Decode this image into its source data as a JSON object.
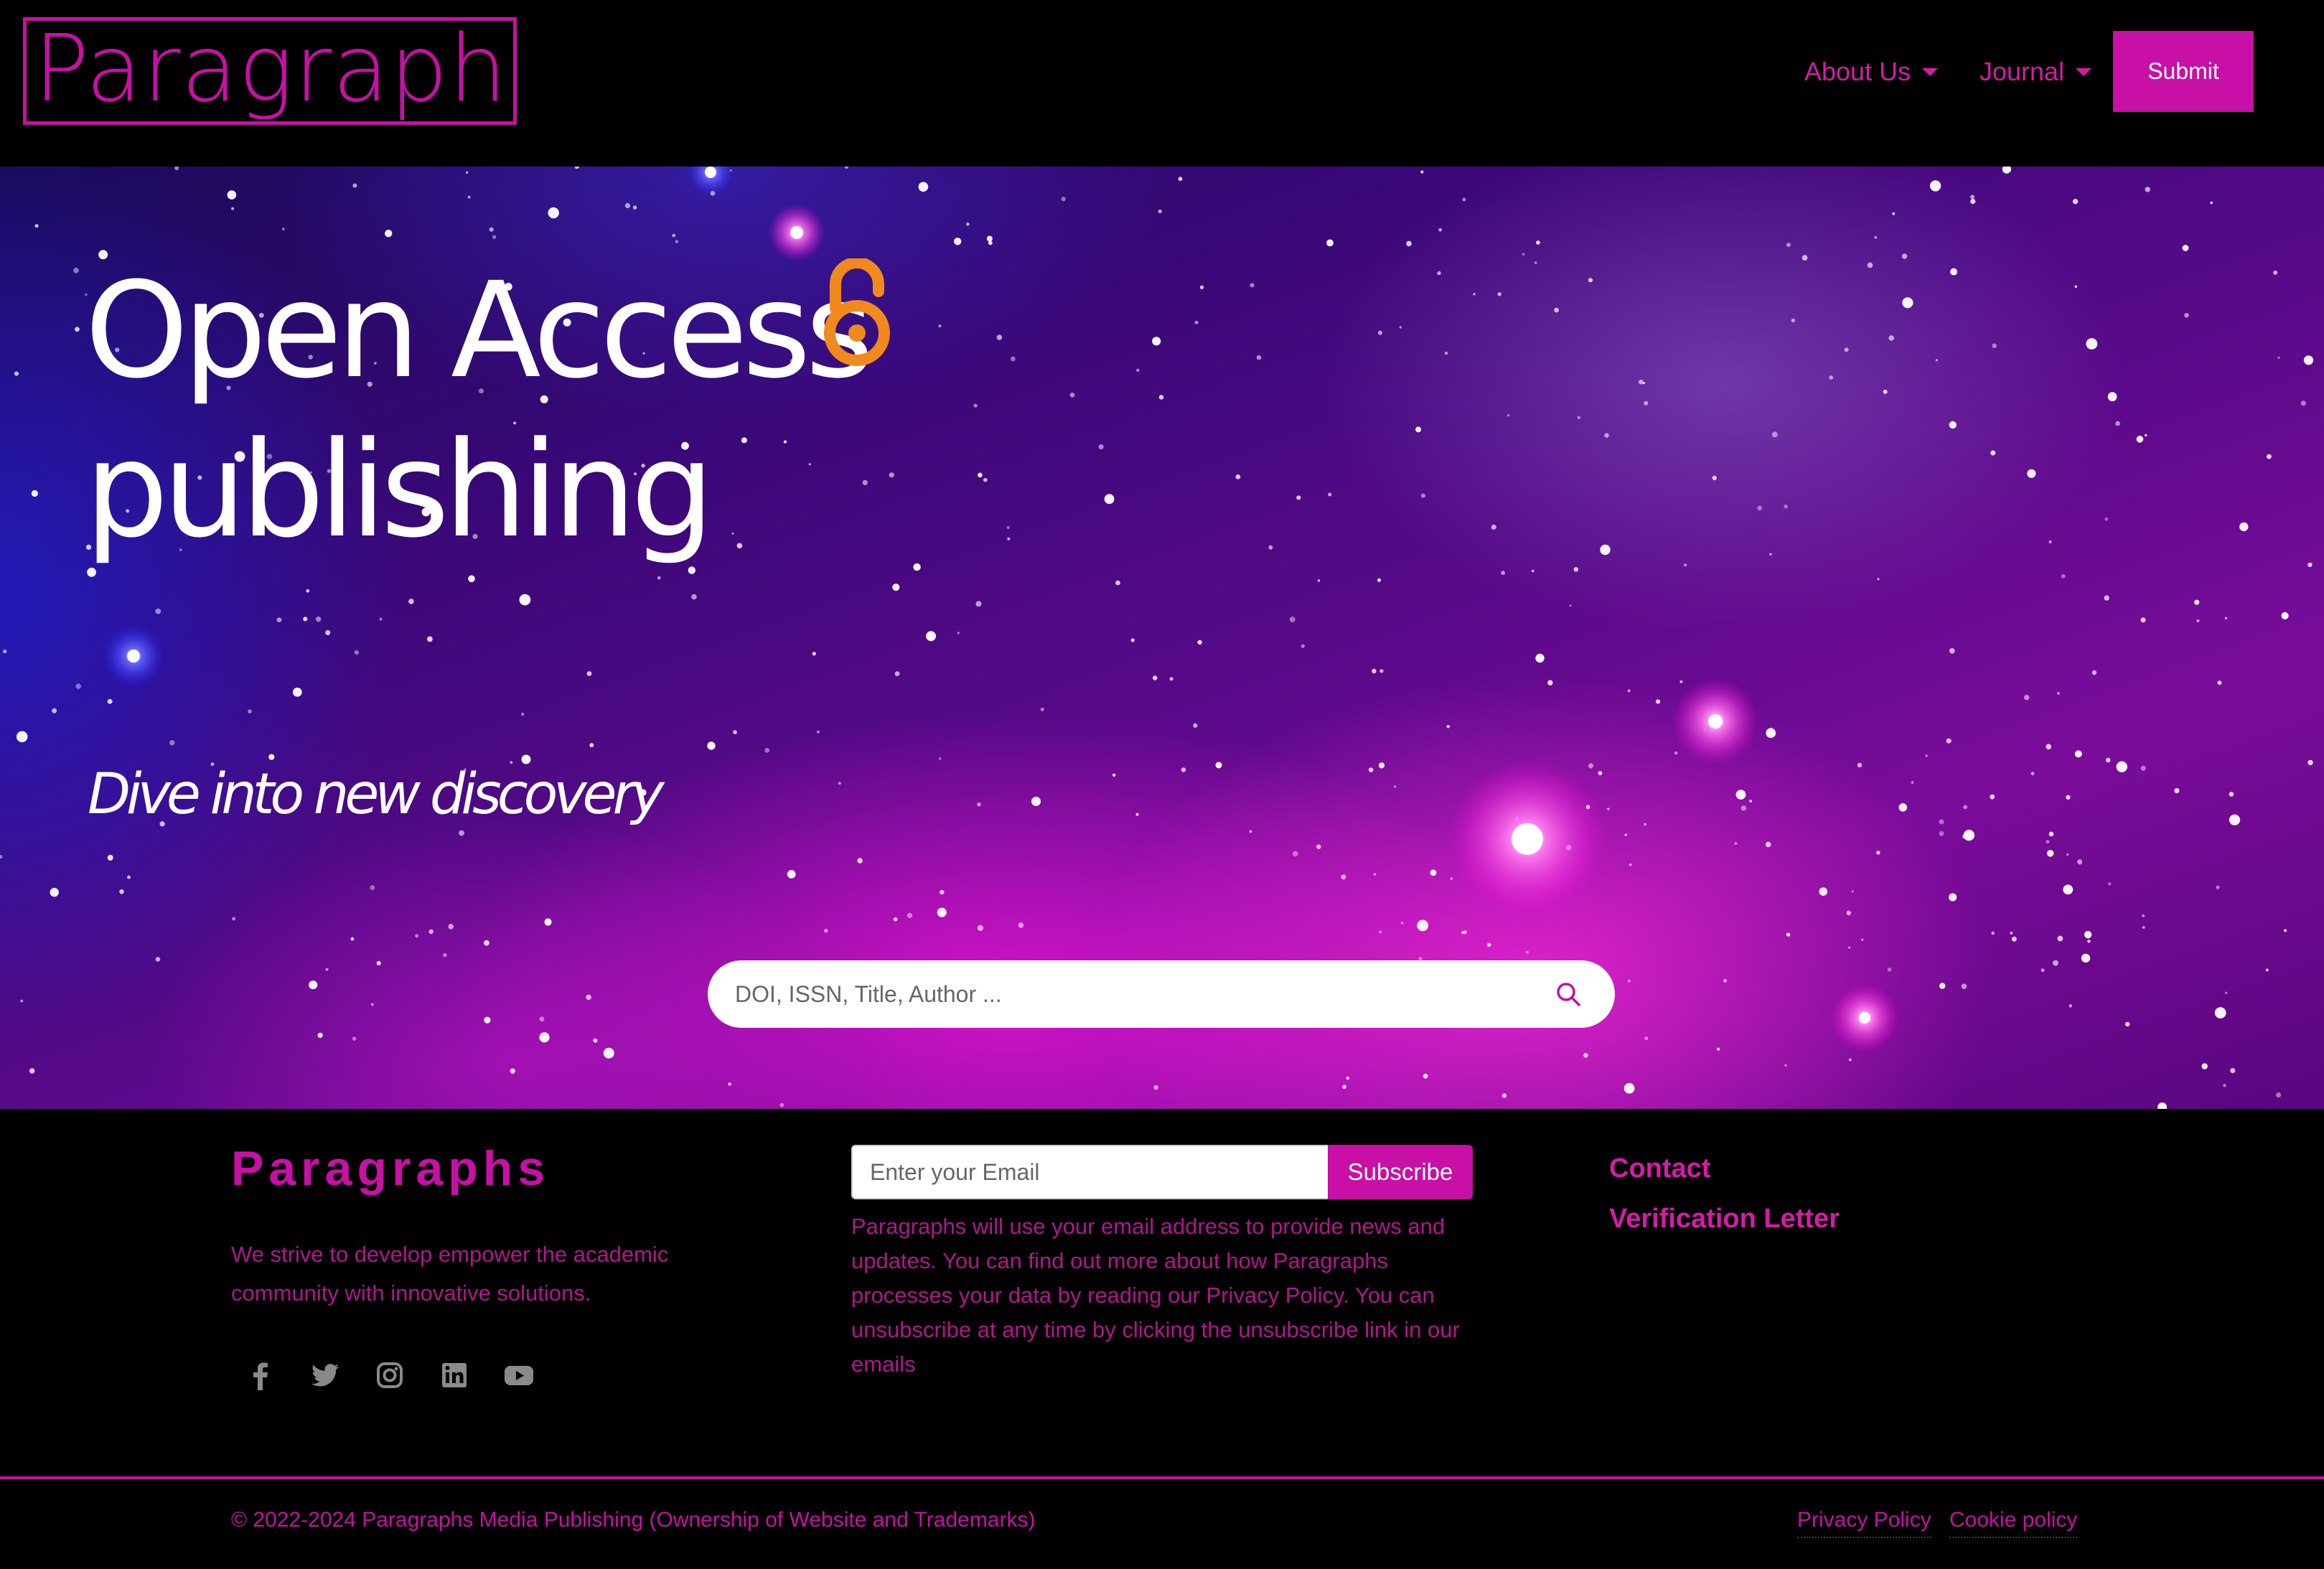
{
  "header": {
    "logo_text": "ParagraphS",
    "nav": [
      {
        "label": "About Us"
      },
      {
        "label": "Journal"
      }
    ],
    "submit_label": "Submit"
  },
  "hero": {
    "title_line1": "Open Access",
    "title_line2": "publishing",
    "subtitle": "Dive into new discovery",
    "search_placeholder": "DOI, ISSN, Title, Author ..."
  },
  "footer": {
    "brand": "Paragraphs",
    "description": "We strive to develop empower the academic community with innovative solutions.",
    "social_icons": [
      "facebook-icon",
      "twitter-icon",
      "instagram-icon",
      "linkedin-icon",
      "youtube-icon"
    ],
    "email_placeholder": "Enter your Email",
    "subscribe_label": "Subscribe",
    "privacy_note": "Paragraphs will use your email address to provide news and updates. You can find out more about how Paragraphs processes your data by reading our Privacy Policy. You can unsubscribe at any time by clicking the unsubscribe link in our emails",
    "links": [
      {
        "label": "Contact"
      },
      {
        "label": "Verification Letter"
      }
    ],
    "copyright": "© 2022-2024 Paragraphs Media Publishing (Ownership of Website and Trademarks)",
    "bottom_links": [
      {
        "label": "Privacy Policy"
      },
      {
        "label": "Cookie policy"
      }
    ]
  },
  "colors": {
    "brand": "#c80fa6",
    "open_access_orange": "#f08a1c",
    "background": "#000000"
  }
}
